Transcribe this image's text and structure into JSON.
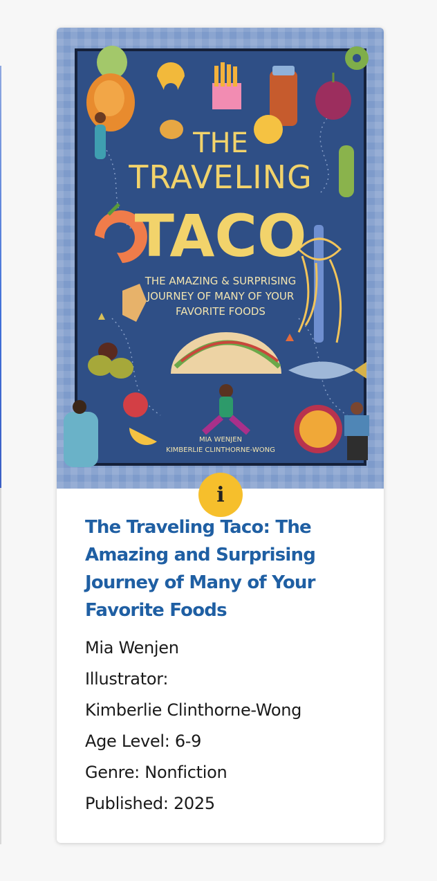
{
  "book": {
    "title": "The Traveling Taco: The Amazing and Surprising Journey of Many of Your Favorite Foods",
    "author": "Mia Wenjen",
    "illustrator_label": "Illustrator:",
    "illustrator": "Kimberlie Clinthorne-Wong",
    "age_level": "Age Level: 6-9",
    "genre": "Genre: Nonfiction",
    "published": "Published: 2025"
  },
  "cover": {
    "title_line1": "THE",
    "title_line2": "TRAVELING",
    "title_line3": "TACO",
    "subtitle_line1": "THE AMAZING & SURPRISING",
    "subtitle_line2": "JOURNEY OF MANY OF YOUR",
    "subtitle_line3": "FAVORITE FOODS",
    "author_line": "MIA WENJEN",
    "illustrator_line": "KIMBERLIE CLINTHORNE-WONG"
  },
  "info_button": {
    "icon": "info-icon",
    "glyph": "i"
  },
  "colors": {
    "title_blue": "#1f5fa3",
    "info_yellow": "#f6bf2c",
    "cover_navy": "#2f4f86",
    "cover_gold": "#f2d36b"
  }
}
